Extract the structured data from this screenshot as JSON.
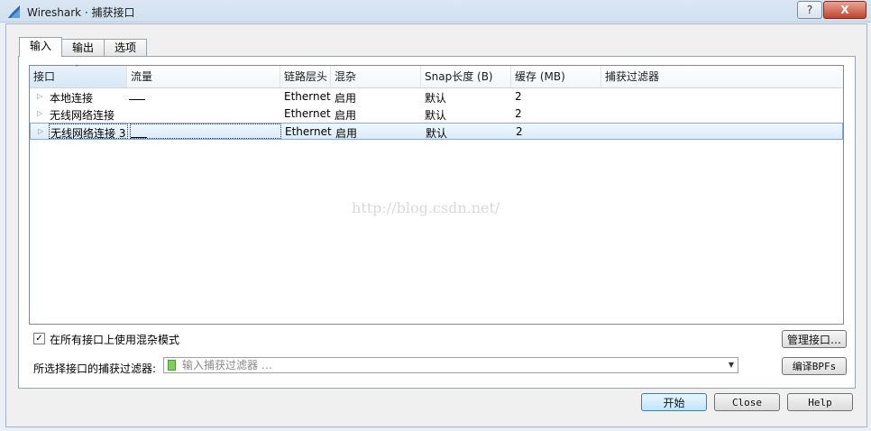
{
  "window": {
    "title": "Wireshark · 捕获接口",
    "help_glyph": "?",
    "close_glyph": "X"
  },
  "tabs": [
    {
      "label": "输入",
      "active": true
    },
    {
      "label": "输出",
      "active": false
    },
    {
      "label": "选项",
      "active": false
    }
  ],
  "table": {
    "sort_indicator": "ˆ",
    "columns": [
      "接口",
      "流量",
      "链路层头",
      "混杂",
      "Snap长度 (B)",
      "缓存 (MB)",
      "捕获过滤器"
    ],
    "rows": [
      {
        "name": "本地连接",
        "link": "Ethernet",
        "promisc": "启用",
        "snap": "默认",
        "buffer": "2",
        "filter": "",
        "selected": false
      },
      {
        "name": "无线网络连接",
        "link": "Ethernet",
        "promisc": "启用",
        "snap": "默认",
        "buffer": "2",
        "filter": "",
        "selected": false
      },
      {
        "name": "无线网络连接 3",
        "link": "Ethernet",
        "promisc": "启用",
        "snap": "默认",
        "buffer": "2",
        "filter": "",
        "selected": true
      }
    ]
  },
  "watermark": "http://blog.csdn.net/",
  "promisc_all": {
    "label": "在所有接口上使用混杂模式",
    "checked": true
  },
  "buttons": {
    "manage": "管理接口…",
    "compile": "编译BPFs",
    "start": "开始",
    "close": "Close",
    "help": "Help"
  },
  "filter": {
    "label": "所选择接口的捕获过滤器:",
    "placeholder": "输入捕获过滤器 …",
    "value": ""
  },
  "colors": {
    "accent": "#3c7fb1",
    "selection": "#d8ebfb",
    "filter_bookmark": "#7ccf5a"
  }
}
